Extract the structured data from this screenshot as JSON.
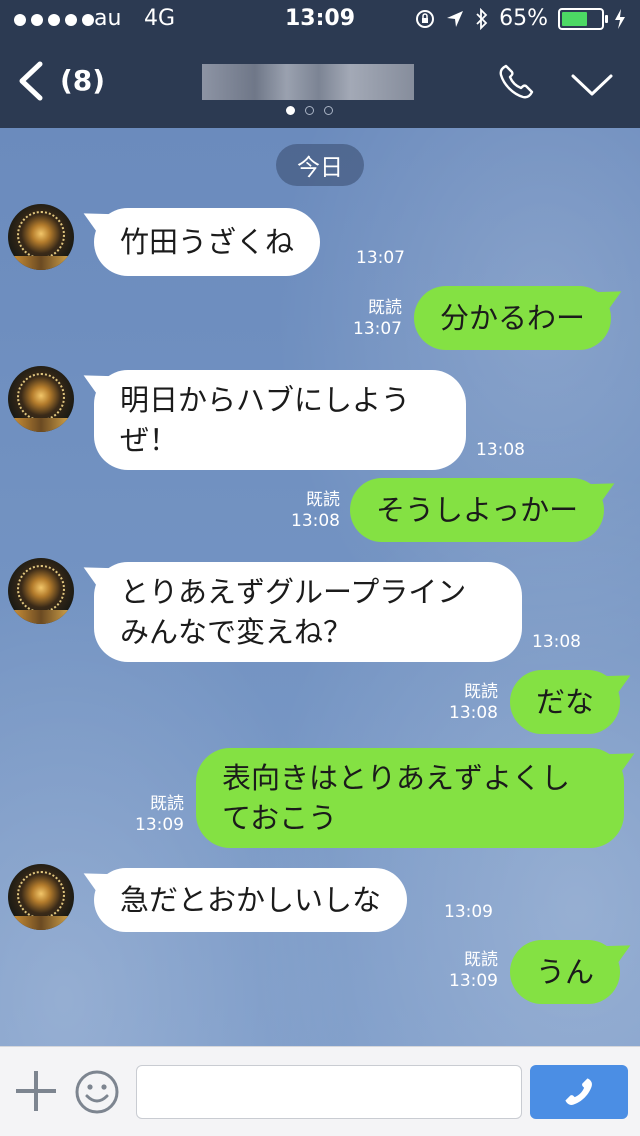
{
  "status_bar": {
    "carrier": "au",
    "network": "4G",
    "time": "13:09",
    "battery_percent": "65%",
    "battery_level": 0.65,
    "battery_color": "#4cd964"
  },
  "nav": {
    "back_icon": "chevron-left-icon",
    "unread_count": "(8)",
    "call_icon": "phone-icon",
    "collapse_icon": "chevron-down-icon",
    "page_indicator": {
      "total": 3,
      "active": 1
    }
  },
  "chat": {
    "date_label": "今日",
    "messages": [
      {
        "side": "in",
        "text": "竹田うざくね",
        "time": "13:07"
      },
      {
        "side": "out",
        "text": "分かるわー",
        "read": "既読",
        "time": "13:07"
      },
      {
        "side": "in",
        "text": "明日からハブにしよう\nぜ！",
        "time": "13:08"
      },
      {
        "side": "out",
        "text": "そうしよっかー",
        "read": "既読",
        "time": "13:08"
      },
      {
        "side": "in",
        "text": "とりあえずグループライン\nみんなで変えね？",
        "time": "13:08"
      },
      {
        "side": "out",
        "text": "だな",
        "read": "既読",
        "time": "13:08"
      },
      {
        "side": "out",
        "text": "表向きはとりあえずよくし\nておこう",
        "read": "既読",
        "time": "13:09"
      },
      {
        "side": "in",
        "text": "急だとおかしいしな",
        "time": "13:09"
      },
      {
        "side": "out",
        "text": "うん",
        "read": "既読",
        "time": "13:09"
      }
    ]
  },
  "input_bar": {
    "plus_icon": "plus-icon",
    "emoji_icon": "smiley-icon",
    "text_value": "",
    "send_icon": "phone-icon",
    "send_color": "#4b8ee4"
  },
  "colors": {
    "header_bg": "#2c3a52",
    "outgoing_bubble": "#84e143",
    "incoming_bubble": "#ffffff"
  }
}
